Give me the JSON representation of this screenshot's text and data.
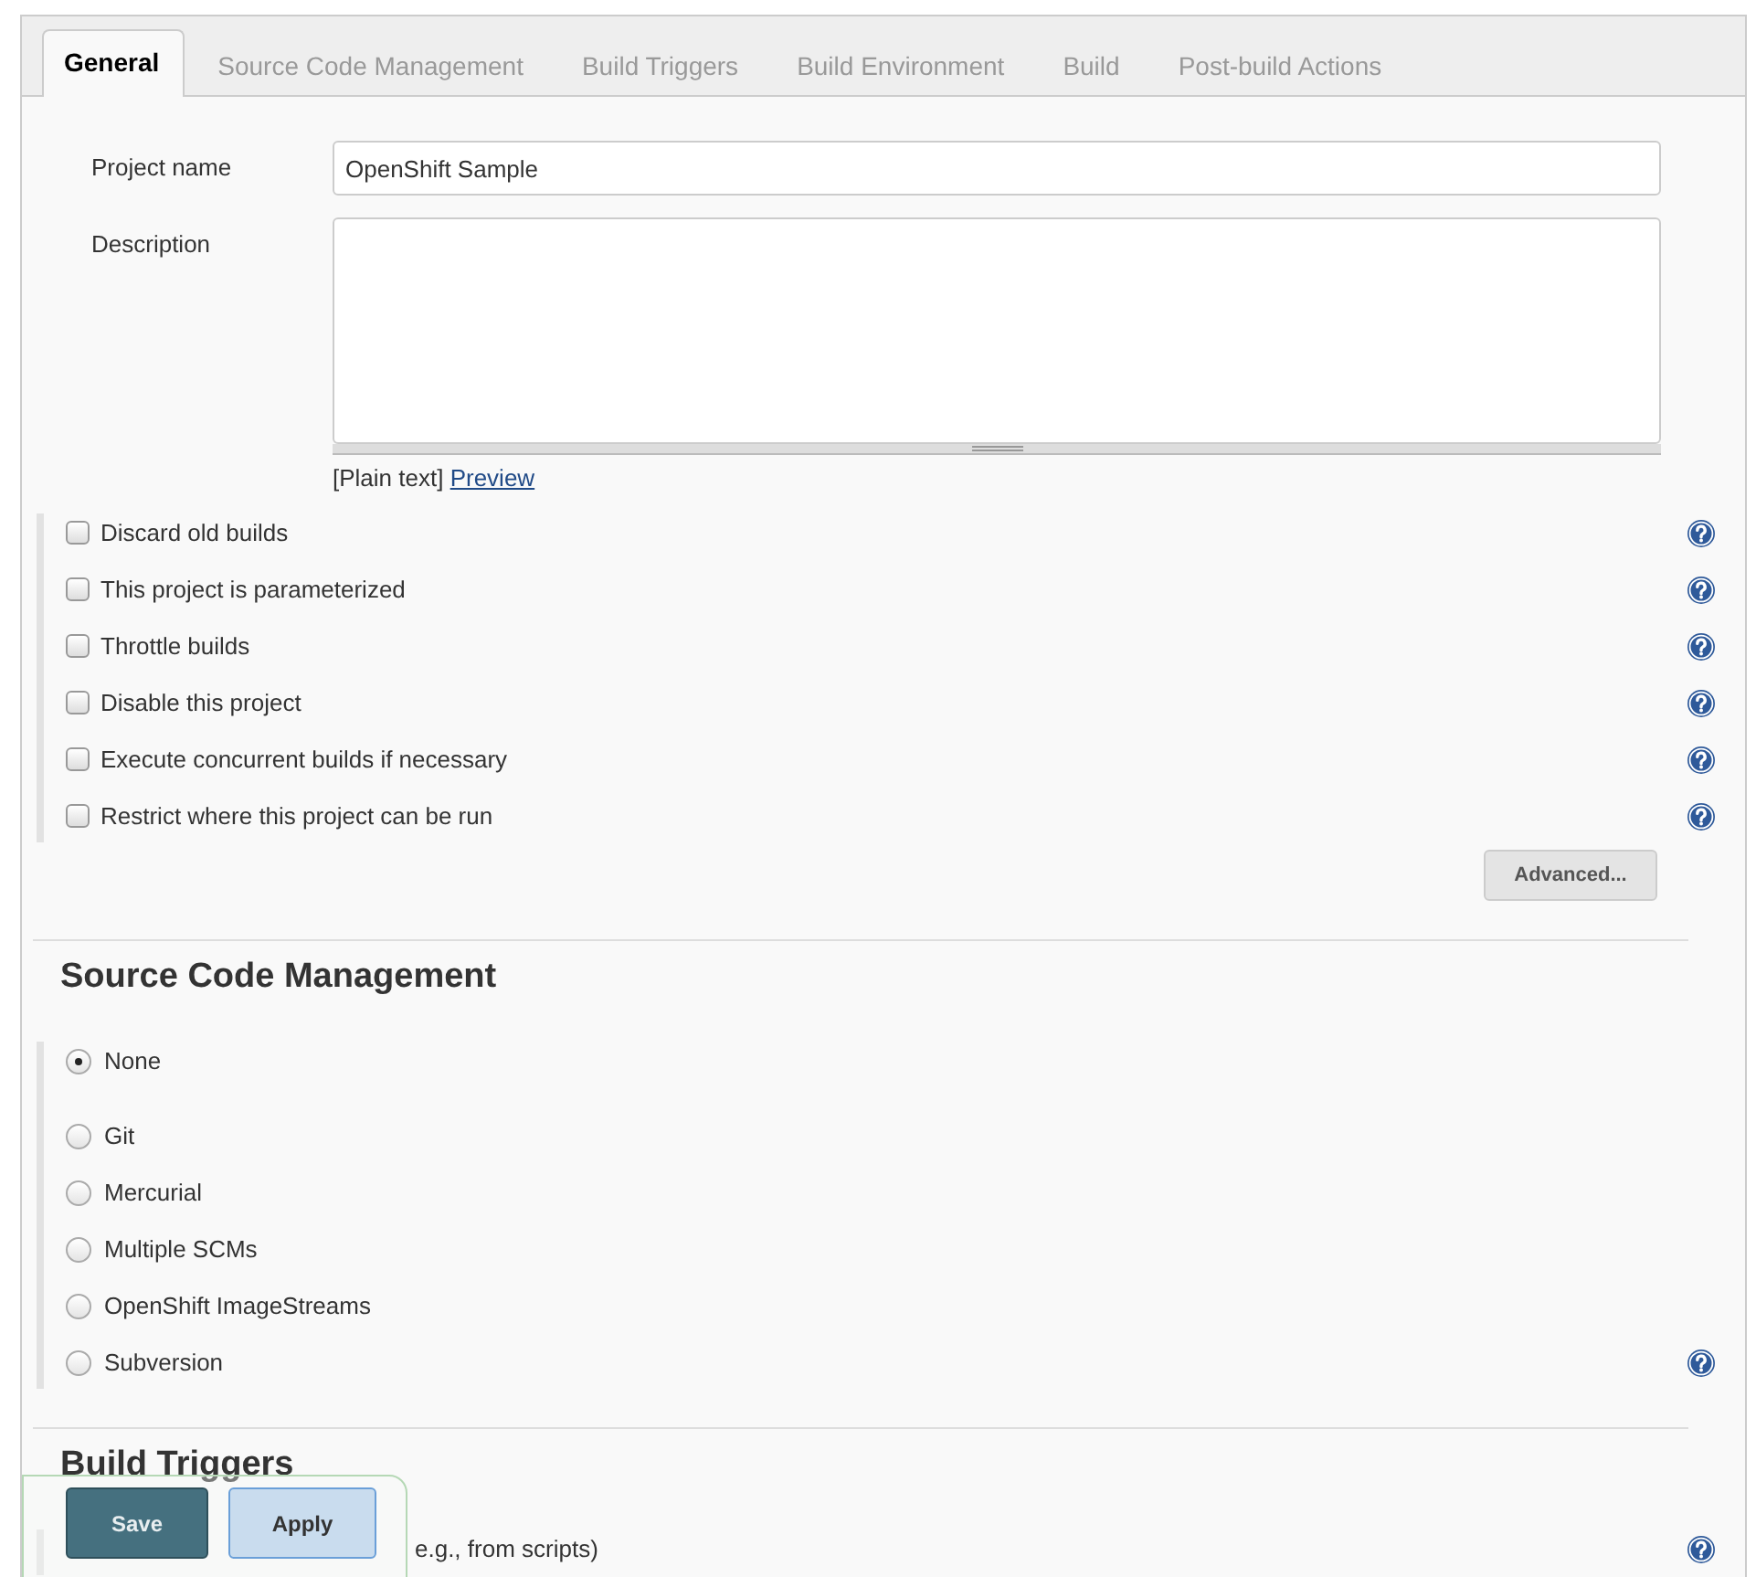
{
  "tabs": [
    {
      "label": "General",
      "selected": true
    },
    {
      "label": "Source Code Management",
      "selected": false
    },
    {
      "label": "Build Triggers",
      "selected": false
    },
    {
      "label": "Build Environment",
      "selected": false
    },
    {
      "label": "Build",
      "selected": false
    },
    {
      "label": "Post-build Actions",
      "selected": false
    }
  ],
  "general": {
    "project_name": {
      "label": "Project name",
      "value": "OpenShift Sample"
    },
    "description": {
      "label": "Description"
    },
    "format_note": {
      "text": "[Plain text]",
      "link": "Preview"
    },
    "options": [
      {
        "label": "Discard old builds",
        "checked": false,
        "help": true
      },
      {
        "label": "This project is parameterized",
        "checked": false,
        "help": true
      },
      {
        "label": "Throttle builds",
        "checked": false,
        "help": true
      },
      {
        "label": "Disable this project",
        "checked": false,
        "help": true
      },
      {
        "label": "Execute concurrent builds if necessary",
        "checked": false,
        "help": true
      },
      {
        "label": "Restrict where this project can be run",
        "checked": false,
        "help": true
      }
    ],
    "advanced_button": "Advanced..."
  },
  "scm": {
    "title": "Source Code Management",
    "options": [
      {
        "label": "None",
        "selected": true,
        "help": false
      },
      {
        "label": "Git",
        "selected": false,
        "help": false
      },
      {
        "label": "Mercurial",
        "selected": false,
        "help": false
      },
      {
        "label": "Multiple SCMs",
        "selected": false,
        "help": false
      },
      {
        "label": "OpenShift ImageStreams",
        "selected": false,
        "help": false
      },
      {
        "label": "Subversion",
        "selected": false,
        "help": true
      }
    ]
  },
  "build_triggers": {
    "title": "Build Triggers",
    "options": [
      {
        "label": "e.g., from scripts)",
        "help": true
      }
    ]
  },
  "actions": [
    {
      "label": "Save",
      "kind": "primary"
    },
    {
      "label": "Apply",
      "kind": "secondary"
    }
  ]
}
